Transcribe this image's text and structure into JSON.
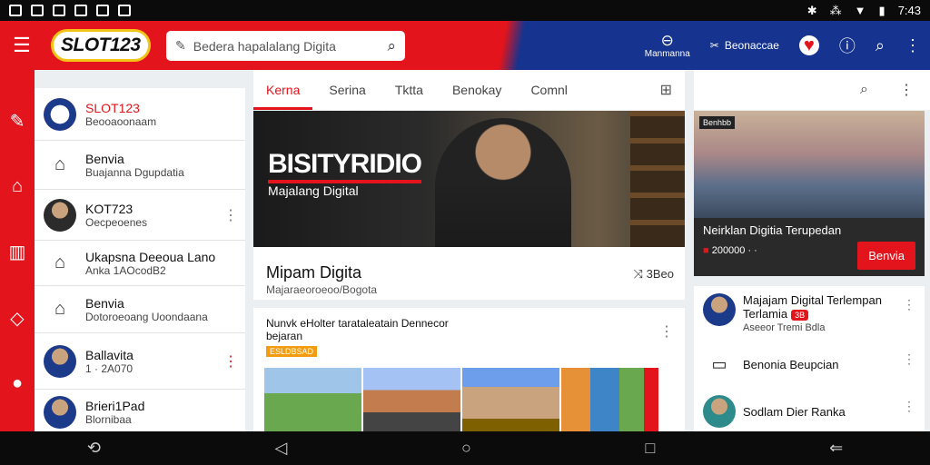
{
  "statusbar": {
    "time": "7:43",
    "icons_left": [
      "notification-icon",
      "image-icon",
      "message-icon",
      "cloud-icon",
      "camera-icon",
      "mail-icon"
    ],
    "icons_right": [
      "bluetooth-icon",
      "vibrate-icon",
      "wifi-icon",
      "battery-icon"
    ]
  },
  "appbar": {
    "logo_text": "SLOT123",
    "search_placeholder": "Bedera hapalalang Digita",
    "action_1_label": "Manmanna",
    "action_2_label": "Beonaccae"
  },
  "sidebar": {
    "items": [
      {
        "title": "SLOT123",
        "subtitle": "Beooaoonaam",
        "kind": "avatar"
      },
      {
        "title": "Benvia",
        "subtitle": "Buajanna Dgupdatia",
        "kind": "home"
      },
      {
        "title": "KOT723",
        "subtitle": "Oecpeoenes",
        "kind": "avatar"
      },
      {
        "title": "Ukapsna Deeoua Lano",
        "subtitle": "Anka 1AOcodB2",
        "kind": "home"
      },
      {
        "title": "Benvia",
        "subtitle": "Dotoroeoang Uoondaana",
        "kind": "home"
      },
      {
        "title": "Ballavita",
        "subtitle": "1 · 2A070",
        "kind": "avatar"
      },
      {
        "title": "Brieri1Pad",
        "subtitle": "Blornibaa",
        "kind": "avatar"
      }
    ]
  },
  "tabs": [
    "Kerna",
    "Serina",
    "Tktta",
    "Benokay",
    "Comnl"
  ],
  "feature": {
    "banner_headline": "BISITYRIDIO",
    "banner_sub": "Majalang Digital",
    "title": "Mipam Digita",
    "subtitle": "Majaraeoroeoo/Bogota",
    "count": "3Beo"
  },
  "card2": {
    "title": "Nunvk eHolter tarataleatain Dennecor bejaran",
    "badge": "ESLDBSAD"
  },
  "rightcol": {
    "feature_tag": "Benhbb",
    "feature_title": "Neirklan Digitia Terupedan",
    "feature_meta": "200000 · ·",
    "feature_button": "Benvia",
    "list": [
      {
        "title": "Majajam Digital Terlempan",
        "title2": "Terlamia",
        "badge": "3B",
        "subtitle": "Aseeor Tremi Bdla"
      },
      {
        "title": "Benonia Beupcian",
        "subtitle": ""
      },
      {
        "title": "Sodlam Dier Ranka",
        "subtitle": ""
      }
    ]
  },
  "colors": {
    "brand_red": "#e3141b",
    "brand_blue": "#15338f"
  }
}
